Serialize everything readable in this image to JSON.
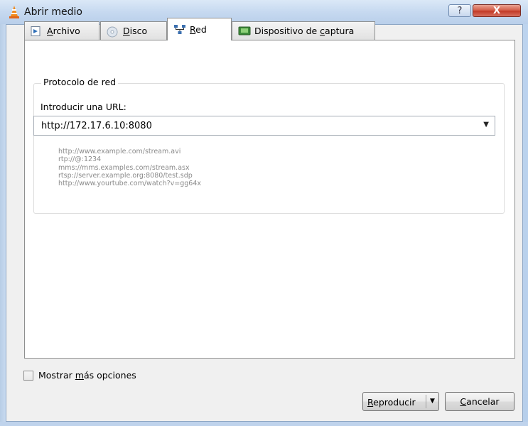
{
  "window": {
    "title": "Abrir medio",
    "help_label": "?",
    "close_label": "X"
  },
  "tabs": [
    {
      "label": "Archivo",
      "mnemonic": "A",
      "rest": "rchivo",
      "icon": "file-icon"
    },
    {
      "label": "Disco",
      "mnemonic": "D",
      "rest": "isco",
      "icon": "disc-icon"
    },
    {
      "label": "Red",
      "mnemonic": "R",
      "rest": "ed",
      "icon": "network-icon",
      "active": true
    },
    {
      "label": "Dispositivo de captura",
      "pre": "Dispositivo de ",
      "mnemonic": "c",
      "rest": "aptura",
      "icon": "capture-device-icon"
    }
  ],
  "network": {
    "group_title": "Protocolo de red",
    "url_label": "Introducir una URL:",
    "url_value": "http://172.17.6.10:8080",
    "examples": [
      "http://www.example.com/stream.avi",
      "rtp://@:1234",
      "mms://mms.examples.com/stream.asx",
      "rtsp://server.example.org:8080/test.sdp",
      "http://www.yourtube.com/watch?v=gg64x"
    ]
  },
  "footer": {
    "more_options_pre": "Mostrar ",
    "more_options_mnemonic": "m",
    "more_options_rest": "ás opciones",
    "play_mnemonic": "R",
    "play_rest": "eproducir",
    "cancel_mnemonic": "C",
    "cancel_rest": "ancelar"
  },
  "colors": {
    "titlebar": "#c6d9f0",
    "close_button": "#c23a27",
    "panel": "#ffffff",
    "dialog_bg": "#f0f0f0"
  }
}
